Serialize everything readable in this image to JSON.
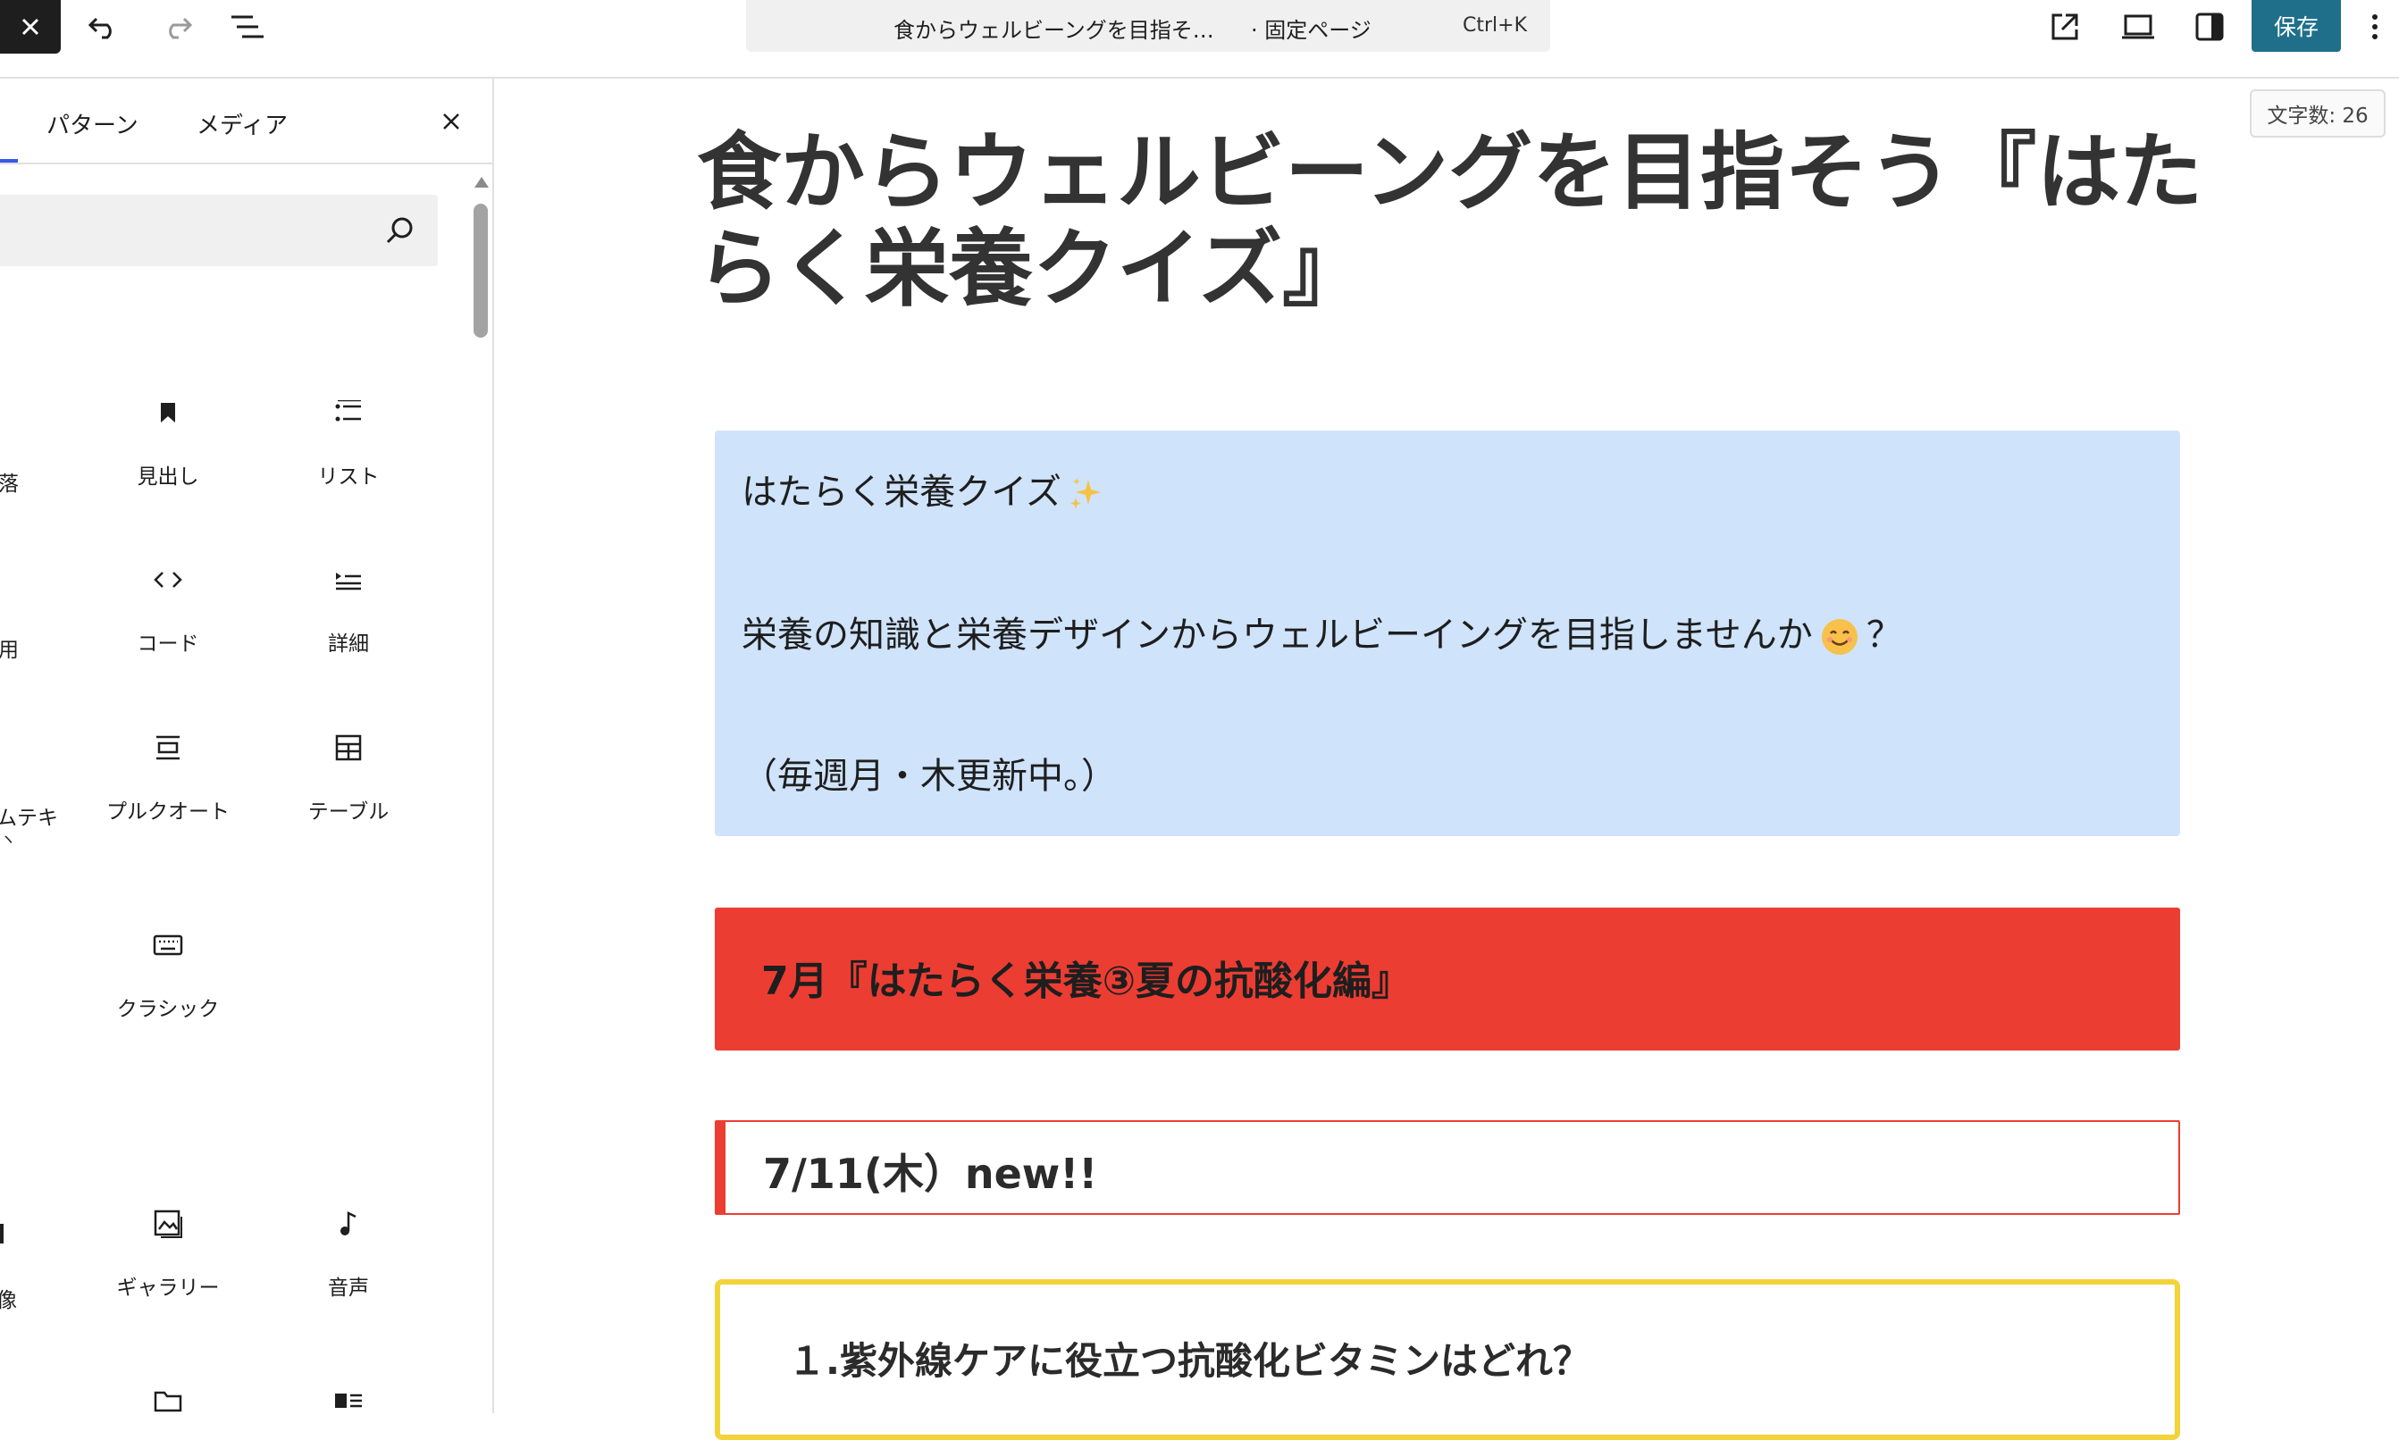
{
  "toolbar": {
    "command_title": "食からウェルビーングを目指そ…",
    "command_type": "· 固定ページ",
    "command_shortcut": "Ctrl+K",
    "save_label": "保存"
  },
  "word_count": "文字数: 26",
  "sidebar": {
    "tabs": [
      {
        "label": "パターン"
      },
      {
        "label": "メディア"
      }
    ],
    "search": {
      "placeholder": ""
    },
    "blocks": [
      {
        "label": "見出し",
        "icon": "bookmark-icon"
      },
      {
        "label": "リスト",
        "icon": "list-icon"
      },
      {
        "label": "コード",
        "icon": "code-icon"
      },
      {
        "label": "詳細",
        "icon": "details-icon"
      },
      {
        "label": "プルクオート",
        "icon": "pullquote-icon"
      },
      {
        "label": "テーブル",
        "icon": "table-icon"
      },
      {
        "label": "クラシック",
        "icon": "keyboard-icon"
      },
      {
        "label": "ギャラリー",
        "icon": "gallery-icon"
      },
      {
        "label": "音声",
        "icon": "audio-icon"
      }
    ],
    "cut_labels": [
      "落",
      "用",
      "ムテキ",
      "ヽ",
      "像"
    ]
  },
  "post": {
    "title": "食からウェルビーングを目指そう『はたらく栄養クイズ』",
    "intro_line1": "はたらく栄養クイズ",
    "intro_line2a": "栄養の知識と栄養デザインからウェルビーイングを目指しませんか",
    "intro_line2b": "？",
    "intro_line3": "（毎週月・木更新中。）",
    "heading_red": "7月『はたらく栄養③夏の抗酸化編』",
    "heading_date": "7/11(木）new!!",
    "quiz_question": "１.紫外線ケアに役立つ抗酸化ビタミンはどれ？"
  },
  "colors": {
    "save_button": "#1f6f8b",
    "intro_background": "#cfe3fb",
    "heading_red": "#ec3d33",
    "quiz_border": "#f2d33a",
    "accent_tab": "#3858e9"
  }
}
